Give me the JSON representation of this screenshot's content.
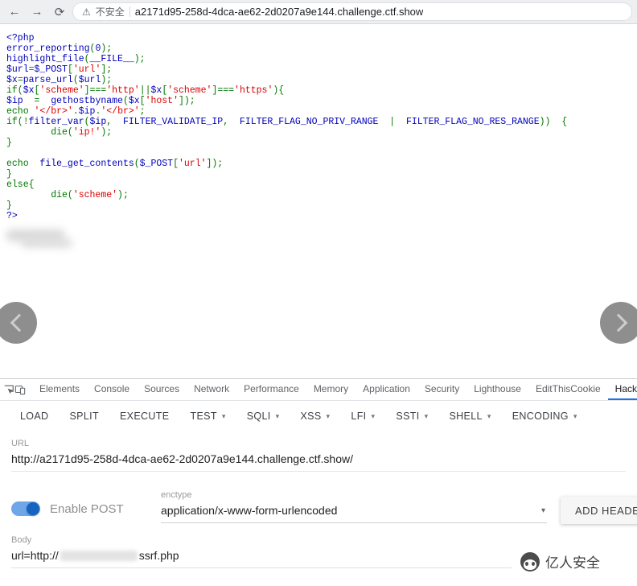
{
  "browser": {
    "back_icon": "←",
    "forward_icon": "→",
    "refresh_icon": "⟳",
    "warning_icon": "⚠",
    "security_label": "不安全",
    "url": "a2171d95-258d-4dca-ae62-2d0207a9e144.challenge.ctf.show"
  },
  "code": {
    "colors": {
      "b": "#0000BB",
      "g": "#007700",
      "r": "#DD0000"
    },
    "lines": [
      [
        [
          "b",
          "<?php"
        ]
      ],
      [
        [
          "b",
          "error_reporting"
        ],
        [
          "g",
          "("
        ],
        [
          "b",
          "0"
        ],
        [
          "g",
          ");"
        ]
      ],
      [
        [
          "b",
          "highlight_file"
        ],
        [
          "g",
          "("
        ],
        [
          "b",
          "__FILE__"
        ],
        [
          "g",
          ");"
        ]
      ],
      [
        [
          "b",
          "$url"
        ],
        [
          "g",
          "="
        ],
        [
          "b",
          "$_POST"
        ],
        [
          "g",
          "["
        ],
        [
          "r",
          "'url'"
        ],
        [
          "g",
          "];"
        ]
      ],
      [
        [
          "b",
          "$x"
        ],
        [
          "g",
          "="
        ],
        [
          "b",
          "parse_url"
        ],
        [
          "g",
          "("
        ],
        [
          "b",
          "$url"
        ],
        [
          "g",
          ");"
        ]
      ],
      [
        [
          "g",
          "if("
        ],
        [
          "b",
          "$x"
        ],
        [
          "g",
          "["
        ],
        [
          "r",
          "'scheme'"
        ],
        [
          "g",
          "]==="
        ],
        [
          "r",
          "'http'"
        ],
        [
          "g",
          "||"
        ],
        [
          "b",
          "$x"
        ],
        [
          "g",
          "["
        ],
        [
          "r",
          "'scheme'"
        ],
        [
          "g",
          "]==="
        ],
        [
          "r",
          "'https'"
        ],
        [
          "g",
          "){"
        ]
      ],
      [
        [
          "b",
          "$ip "
        ],
        [
          "g",
          " = "
        ],
        [
          "b",
          " gethostbyname"
        ],
        [
          "g",
          "("
        ],
        [
          "b",
          "$x"
        ],
        [
          "g",
          "["
        ],
        [
          "r",
          "'host'"
        ],
        [
          "g",
          "]);"
        ]
      ],
      [
        [
          "g",
          "echo "
        ],
        [
          "r",
          "'</br>'"
        ],
        [
          "g",
          "."
        ],
        [
          "b",
          "$ip"
        ],
        [
          "g",
          "."
        ],
        [
          "r",
          "'</br>'"
        ],
        [
          "g",
          ";"
        ]
      ],
      [
        [
          "g",
          "if(!"
        ],
        [
          "b",
          "filter_var"
        ],
        [
          "g",
          "("
        ],
        [
          "b",
          "$ip"
        ],
        [
          "g",
          ",  "
        ],
        [
          "b",
          "FILTER_VALIDATE_IP"
        ],
        [
          "g",
          ",  "
        ],
        [
          "b",
          "FILTER_FLAG_NO_PRIV_RANGE "
        ],
        [
          "g",
          " |  "
        ],
        [
          "b",
          "FILTER_FLAG_NO_RES_RANGE"
        ],
        [
          "g",
          "))  {"
        ]
      ],
      [
        [
          "g",
          "        die("
        ],
        [
          "r",
          "'ip!'"
        ],
        [
          "g",
          ");"
        ]
      ],
      [
        [
          "g",
          "}"
        ]
      ],
      [],
      [
        [
          "g",
          "echo  "
        ],
        [
          "b",
          "file_get_contents"
        ],
        [
          "g",
          "("
        ],
        [
          "b",
          "$_POST"
        ],
        [
          "g",
          "["
        ],
        [
          "r",
          "'url'"
        ],
        [
          "g",
          "]);"
        ]
      ],
      [
        [
          "g",
          "}"
        ]
      ],
      [
        [
          "g",
          "else{"
        ]
      ],
      [
        [
          "g",
          "        die("
        ],
        [
          "r",
          "'scheme'"
        ],
        [
          "g",
          ");"
        ]
      ],
      [
        [
          "g",
          "}"
        ]
      ],
      [
        [
          "b",
          "?>"
        ]
      ]
    ]
  },
  "devtools": {
    "tabs": [
      "Elements",
      "Console",
      "Sources",
      "Network",
      "Performance",
      "Memory",
      "Application",
      "Security",
      "Lighthouse",
      "EditThisCookie",
      "HackBar"
    ],
    "active_tab": "HackBar"
  },
  "hackbar": {
    "buttons": [
      {
        "label": "LOAD",
        "dropdown": false
      },
      {
        "label": "SPLIT",
        "dropdown": false
      },
      {
        "label": "EXECUTE",
        "dropdown": false
      },
      {
        "label": "TEST",
        "dropdown": true
      },
      {
        "label": "SQLI",
        "dropdown": true
      },
      {
        "label": "XSS",
        "dropdown": true
      },
      {
        "label": "LFI",
        "dropdown": true
      },
      {
        "label": "SSTI",
        "dropdown": true
      },
      {
        "label": "SHELL",
        "dropdown": true
      },
      {
        "label": "ENCODING",
        "dropdown": true
      }
    ],
    "caret_icon": "▾",
    "url_label": "URL",
    "url_value": "http://a2171d95-258d-4dca-ae62-2d0207a9e144.challenge.ctf.show/",
    "enable_post_label": "Enable POST",
    "enctype_label": "enctype",
    "enctype_value": "application/x-www-form-urlencoded",
    "add_header_label": "ADD HEADER",
    "body_label": "Body",
    "body_value_prefix": "url=http://",
    "body_value_suffix": "ssrf.php"
  },
  "watermark": {
    "text": "亿人安全"
  }
}
